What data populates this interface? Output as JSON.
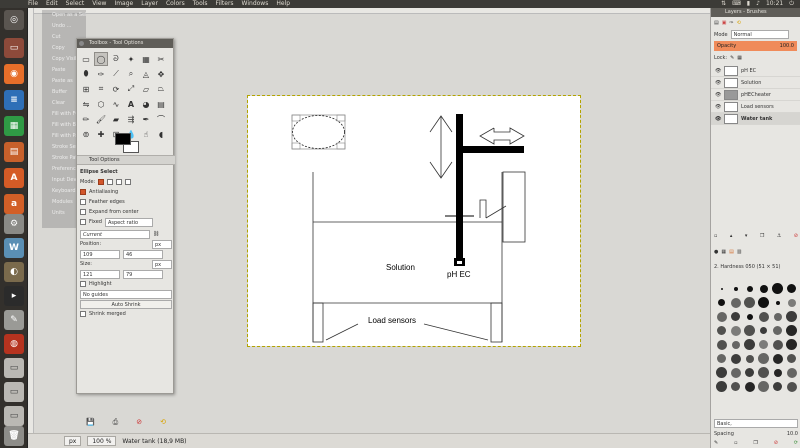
{
  "menubar": {
    "items": [
      "File",
      "Edit",
      "Select",
      "View",
      "Image",
      "Layer",
      "Colors",
      "Tools",
      "Filters",
      "Windows",
      "Help"
    ],
    "clock": "10:21"
  },
  "image_menu_ghost": {
    "items": [
      "Open as a Selection",
      "Undo ...",
      "Cut",
      "Copy",
      "Copy Visible",
      "Paste",
      "Paste as",
      "Buffer",
      "Clear",
      "Fill with FG Color",
      "Fill with BG Color",
      "Fill with Pattern",
      "Stroke Selection",
      "Stroke Path",
      "Preferences",
      "Input Devices",
      "Keyboard Shortcuts",
      "Modules",
      "Units"
    ]
  },
  "toolbox": {
    "title": "Toolbox - Tool Options",
    "tab_label": "Tool Options",
    "tool_name": "Ellipse Select",
    "mode_label": "Mode:",
    "antialiasing": "Antialiasing",
    "feather_edges": "Feather edges",
    "expand_from_center": "Expand from center",
    "fixed_label": "Fixed",
    "fixed_value": "Aspect ratio",
    "fixed_field": "Current",
    "position_label": "Position:",
    "position_unit": "px",
    "position_x": "109",
    "position_y": "46",
    "size_label": "Size:",
    "size_unit": "px",
    "size_w": "121",
    "size_h": "79",
    "highlight": "Highlight",
    "guides": "No guides",
    "auto_shrink": "Auto Shrink",
    "shrink_merged": "Shrink merged"
  },
  "canvas": {
    "labels": {
      "solution": "Solution",
      "ph_ec": "pH EC",
      "load_sensors": "Load sensors"
    }
  },
  "statusbar": {
    "unit": "px",
    "zoom": "100 %",
    "info": "Water tank (18,9 MB)"
  },
  "layers_dock": {
    "title": "Layers - Brushes",
    "mode_label": "Mode",
    "mode_value": "Normal",
    "opacity_label": "Opacity",
    "opacity_value": "100.0",
    "lock_label": "Lock:",
    "layers": [
      {
        "name": "pH EC"
      },
      {
        "name": "Solution"
      },
      {
        "name": "pHECheater"
      },
      {
        "name": "Load sensors"
      },
      {
        "name": "Water tank",
        "active": true
      }
    ],
    "brush_name": "2. Hardness 050 (51 × 51)",
    "brush_tag": "Basic,",
    "spacing_label": "Spacing",
    "spacing_value": "10.0"
  },
  "colors": {
    "accent": "#f08b5a",
    "topbar": "#3c3b37",
    "selection": "#b3a400"
  }
}
